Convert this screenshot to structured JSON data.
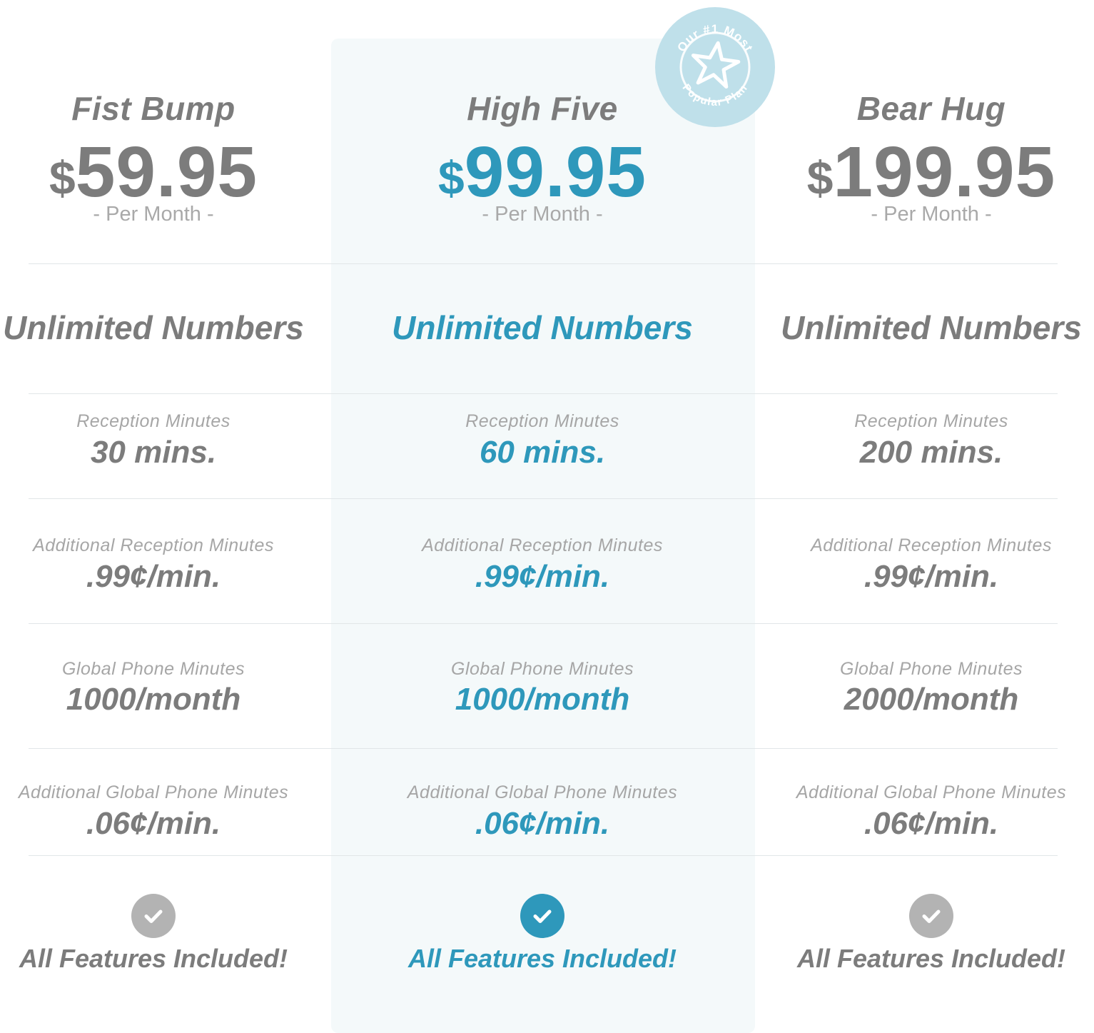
{
  "colors": {
    "accent": "#2e98bb",
    "muted_text": "#7c7c7c",
    "label_text": "#a6a6a6",
    "featured_background": "#f4f9fa",
    "badge": "#bfe0ea",
    "check_inactive": "#b3b3b3"
  },
  "badge": {
    "top_text": "Our #1 Most",
    "bottom_text": "Popular Plan",
    "icon": "star-icon"
  },
  "plans": [
    {
      "name": "Fist Bump",
      "currency": "$",
      "price": "59.95",
      "period": "- Per Month -",
      "numbers": "Unlimited Numbers",
      "features": [
        {
          "label": "Reception Minutes",
          "value": "30 mins."
        },
        {
          "label": "Additional Reception Minutes",
          "value": ".99¢/min."
        },
        {
          "label": "Global Phone Minutes",
          "value": "1000/month"
        },
        {
          "label": "Additional Global Phone Minutes",
          "value": ".06¢/min."
        }
      ],
      "check_icon": "check-circle-icon",
      "all_features": "All Features Included!",
      "highlighted": false
    },
    {
      "name": "High Five",
      "currency": "$",
      "price": "99.95",
      "period": "- Per Month -",
      "numbers": "Unlimited Numbers",
      "features": [
        {
          "label": "Reception Minutes",
          "value": "60 mins."
        },
        {
          "label": "Additional Reception Minutes",
          "value": ".99¢/min."
        },
        {
          "label": "Global Phone Minutes",
          "value": "1000/month"
        },
        {
          "label": "Additional Global Phone Minutes",
          "value": ".06¢/min."
        }
      ],
      "check_icon": "check-circle-icon",
      "all_features": "All Features Included!",
      "highlighted": true
    },
    {
      "name": "Bear Hug",
      "currency": "$",
      "price": "199.95",
      "period": "- Per Month -",
      "numbers": "Unlimited Numbers",
      "features": [
        {
          "label": "Reception Minutes",
          "value": "200 mins."
        },
        {
          "label": "Additional Reception Minutes",
          "value": ".99¢/min."
        },
        {
          "label": "Global Phone Minutes",
          "value": "2000/month"
        },
        {
          "label": "Additional Global Phone Minutes",
          "value": ".06¢/min."
        }
      ],
      "check_icon": "check-circle-icon",
      "all_features": "All Features Included!",
      "highlighted": false
    }
  ]
}
